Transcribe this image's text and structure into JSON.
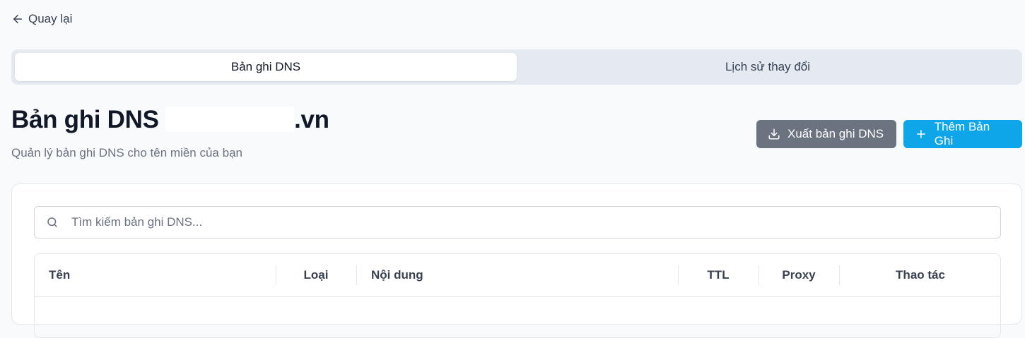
{
  "nav": {
    "back_label": "Quay lại"
  },
  "tabs": [
    {
      "label": "Bản ghi DNS",
      "active": true
    },
    {
      "label": "Lịch sử thay đổi",
      "active": false
    }
  ],
  "header": {
    "title_prefix": "Bản ghi DNS",
    "title_suffix": ".vn",
    "subtitle": "Quản lý bản ghi DNS cho tên miền của bạn"
  },
  "actions": {
    "export_label": "Xuất bản ghi DNS",
    "add_label": "Thêm Bản Ghi"
  },
  "search": {
    "placeholder": "Tìm kiếm bản ghi DNS...",
    "value": ""
  },
  "table": {
    "columns": [
      "Tên",
      "Loại",
      "Nội dung",
      "TTL",
      "Proxy",
      "Thao tác"
    ]
  },
  "colors": {
    "export_button": "#6b7280",
    "add_button": "#0ea5e9",
    "tab_track": "#e5e9f0"
  }
}
